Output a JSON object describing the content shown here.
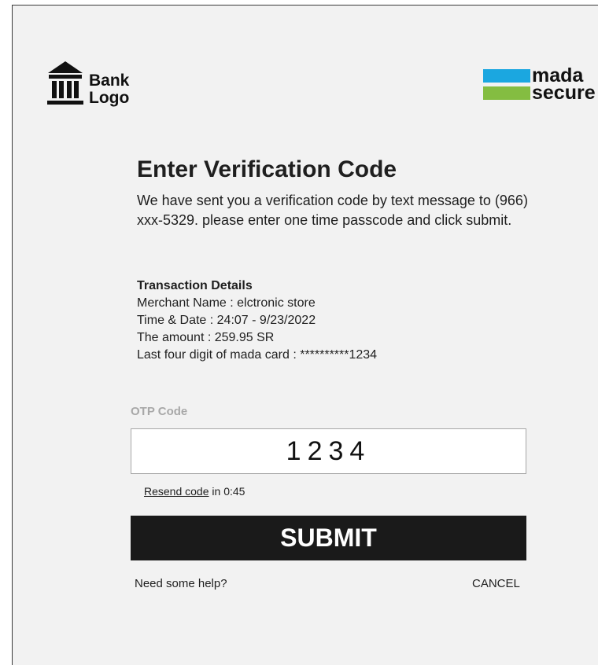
{
  "header": {
    "bank_logo": {
      "line1": "Bank",
      "line2": "Logo"
    },
    "mada_logo": {
      "line1": "mada",
      "line2": "secure"
    }
  },
  "main": {
    "title": "Enter Verification Code",
    "intro": "We have sent you a verification code by text message to (966) xxx-5329. please enter one time passcode and click submit.",
    "details": {
      "heading": "Transaction Details",
      "merchant": "Merchant Name : elctronic store",
      "time_date": "Time & Date : 24:07 - 9/23/2022",
      "amount": "The amount : 259.95 SR",
      "card": "Last four digit of mada card : **********1234"
    },
    "otp": {
      "label": "OTP Code",
      "value": "1234"
    },
    "resend": {
      "link": "Resend code",
      "suffix": " in 0:45"
    },
    "submit_label": "SUBMIT",
    "help_label": "Need some help?",
    "cancel_label": "CANCEL"
  },
  "colors": {
    "mada_blue": "#1ba7e0",
    "mada_green": "#84bd41",
    "submit_bg": "#1a1a1a",
    "background": "#f2f2f2"
  }
}
